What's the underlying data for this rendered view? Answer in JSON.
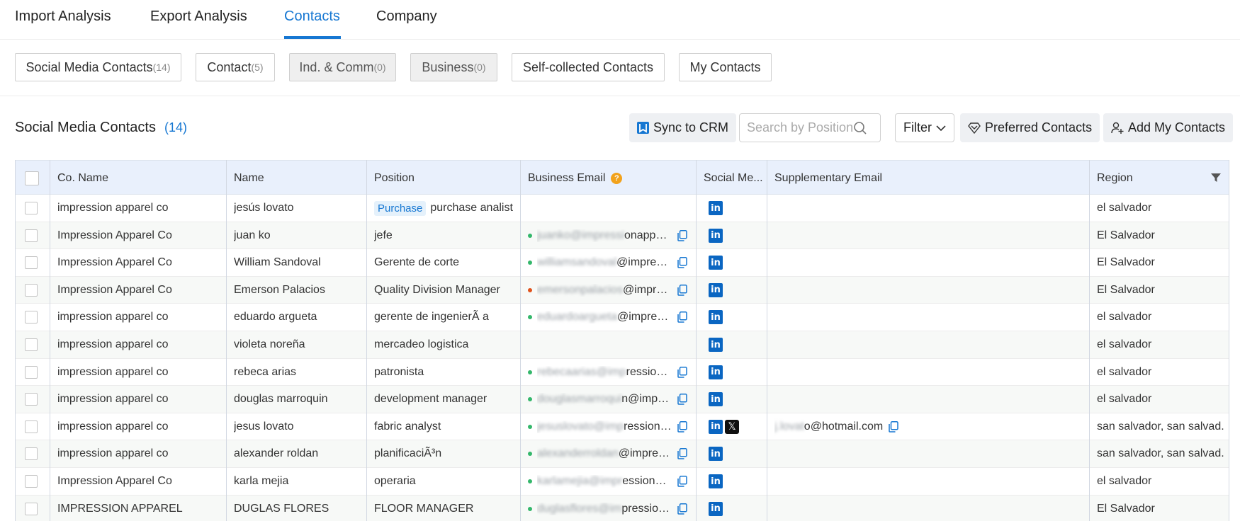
{
  "top_tabs": [
    "Import Analysis",
    "Export Analysis",
    "Contacts",
    "Company"
  ],
  "active_top_tab": "Contacts",
  "sub_tabs": [
    {
      "label": "Social Media Contacts",
      "count": "(14)"
    },
    {
      "label": "Contact",
      "count": "(5)"
    },
    {
      "label": "Ind. & Comm",
      "count": "(0)"
    },
    {
      "label": "Business",
      "count": "(0)"
    },
    {
      "label": "Self-collected Contacts",
      "count": ""
    },
    {
      "label": "My Contacts",
      "count": ""
    }
  ],
  "section": {
    "title": "Social Media Contacts",
    "count": "(14)"
  },
  "toolbar": {
    "sync_label": "Sync to CRM",
    "search_placeholder": "Search by Position",
    "filter_label": "Filter",
    "preferred_label": "Preferred Contacts",
    "add_label": "Add My Contacts"
  },
  "table": {
    "headers": {
      "company": "Co. Name",
      "name": "Name",
      "position": "Position",
      "email": "Business Email",
      "social": "Social Me...",
      "supp_email": "Supplementary Email",
      "region": "Region"
    },
    "help_symbol": "?",
    "rows": [
      {
        "company": "impression apparel co",
        "name": "jesús lovato",
        "tag": "Purchase",
        "position": "purchase analist",
        "email_hidden": "",
        "email_visible": "",
        "status": "",
        "social": [
          "linkedin"
        ],
        "supp_hidden": "",
        "supp_visible": "",
        "region": "el salvador"
      },
      {
        "company": "Impression Apparel Co",
        "name": "juan ko",
        "tag": "",
        "position": "jefe",
        "email_hidden": "juanko@impressi",
        "email_visible": "onappare...",
        "status": "green",
        "social": [
          "linkedin"
        ],
        "supp_hidden": "",
        "supp_visible": "",
        "region": "El Salvador"
      },
      {
        "company": "Impression Apparel Co",
        "name": "William Sandoval",
        "tag": "",
        "position": "Gerente de corte",
        "email_hidden": "williamsandoval",
        "email_visible": "@impressi...",
        "status": "green",
        "social": [
          "linkedin"
        ],
        "supp_hidden": "",
        "supp_visible": "",
        "region": "El Salvador"
      },
      {
        "company": "Impression Apparel Co",
        "name": "Emerson Palacios",
        "tag": "",
        "position": "Quality Division Manager",
        "email_hidden": "emersonpalacios",
        "email_visible": "@impres...",
        "status": "orange",
        "social": [
          "linkedin"
        ],
        "supp_hidden": "",
        "supp_visible": "",
        "region": "El Salvador"
      },
      {
        "company": "impression apparel co",
        "name": "eduardo argueta",
        "tag": "",
        "position": "gerente de ingenierÃ a",
        "email_hidden": "eduardoargueta",
        "email_visible": "@impressi...",
        "status": "green",
        "social": [
          "linkedin"
        ],
        "supp_hidden": "",
        "supp_visible": "",
        "region": "el salvador"
      },
      {
        "company": "impression apparel co",
        "name": "violeta noreña",
        "tag": "",
        "position": "mercadeo logistica",
        "email_hidden": "",
        "email_visible": "",
        "status": "",
        "social": [
          "linkedin"
        ],
        "supp_hidden": "",
        "supp_visible": "",
        "region": "el salvador"
      },
      {
        "company": "impression apparel co",
        "name": "rebeca arias",
        "tag": "",
        "position": "patronista",
        "email_hidden": "rebecaarias@imp",
        "email_visible": "ressiona...",
        "status": "green",
        "social": [
          "linkedin"
        ],
        "supp_hidden": "",
        "supp_visible": "",
        "region": "el salvador"
      },
      {
        "company": "impression apparel co",
        "name": "douglas marroquin",
        "tag": "",
        "position": "development manager",
        "email_hidden": "douglasmarroqui",
        "email_visible": "n@impre...",
        "status": "green",
        "social": [
          "linkedin"
        ],
        "supp_hidden": "",
        "supp_visible": "",
        "region": "el salvador"
      },
      {
        "company": "impression apparel co",
        "name": "jesus lovato",
        "tag": "",
        "position": "fabric analyst",
        "email_hidden": "jesuslovato@imp",
        "email_visible": "ressiona...",
        "status": "green",
        "social": [
          "linkedin",
          "x"
        ],
        "supp_hidden": "j.lovat",
        "supp_visible": "o@hotmail.com",
        "region": "san salvador, san salvad..."
      },
      {
        "company": "impression apparel co",
        "name": "alexander roldan",
        "tag": "",
        "position": "planificaciÃ³n",
        "email_hidden": "alexanderroldan",
        "email_visible": "@impressi...",
        "status": "green",
        "social": [
          "linkedin"
        ],
        "supp_hidden": "",
        "supp_visible": "",
        "region": "san salvador, san salvad..."
      },
      {
        "company": "Impression Apparel Co",
        "name": "karla mejia",
        "tag": "",
        "position": "operaria",
        "email_hidden": "karlamejia@impr",
        "email_visible": "essionap...",
        "status": "green",
        "social": [
          "linkedin"
        ],
        "supp_hidden": "",
        "supp_visible": "",
        "region": "el salvador"
      },
      {
        "company": "IMPRESSION APPAREL",
        "name": "DUGLAS FLORES",
        "tag": "",
        "position": "FLOOR MANAGER",
        "email_hidden": "duglasflores@im",
        "email_visible": "pressiona...",
        "status": "green",
        "social": [
          "linkedin"
        ],
        "supp_hidden": "",
        "supp_visible": "",
        "region": "El Salvador"
      }
    ]
  },
  "colors": {
    "accent": "#1677d2",
    "header_bg": "#e9f0fc",
    "linkedin": "#0a66c2",
    "status_green": "#34b76b",
    "status_orange": "#e0531c"
  }
}
